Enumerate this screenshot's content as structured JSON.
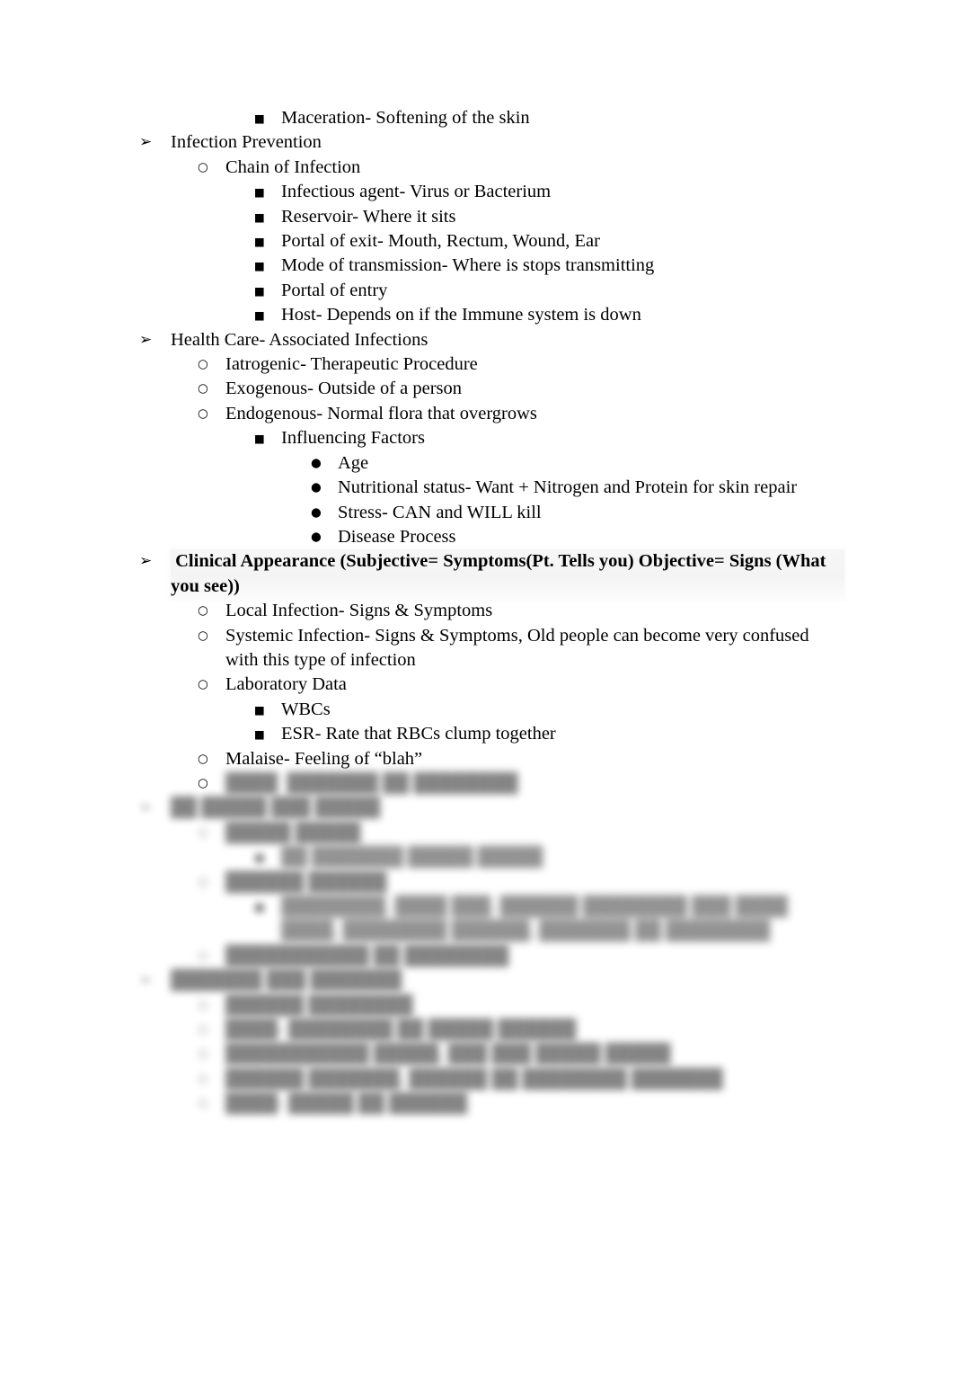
{
  "document": {
    "type": "outline-notes",
    "page_background": "#ffffff",
    "text_color": "#000000",
    "highlight_color": "#efefef",
    "bullet_glyphs": {
      "level_1": "➢",
      "level_2": "○",
      "level_3": "■",
      "level_4": "●"
    },
    "outline": [
      {
        "id": "l01",
        "level": 3,
        "text": "Maceration- Softening of the skin",
        "bold": false,
        "obscured": false
      },
      {
        "id": "l02",
        "level": 1,
        "text": "Infection Prevention",
        "bold": false,
        "obscured": false
      },
      {
        "id": "l03",
        "level": 2,
        "text": "Chain of Infection",
        "bold": false,
        "obscured": false
      },
      {
        "id": "l04",
        "level": 3,
        "text": "Infectious agent- Virus or Bacterium",
        "bold": false,
        "obscured": false
      },
      {
        "id": "l05",
        "level": 3,
        "text": "Reservoir- Where it sits",
        "bold": false,
        "obscured": false
      },
      {
        "id": "l06",
        "level": 3,
        "text": "Portal of exit- Mouth, Rectum, Wound, Ear",
        "bold": false,
        "obscured": false
      },
      {
        "id": "l07",
        "level": 3,
        "text": "Mode of transmission- Where is stops transmitting",
        "bold": false,
        "obscured": false
      },
      {
        "id": "l08",
        "level": 3,
        "text": "Portal of entry",
        "bold": false,
        "obscured": false
      },
      {
        "id": "l09",
        "level": 3,
        "text": "Host- Depends on if the Immune system is down",
        "bold": false,
        "obscured": false
      },
      {
        "id": "l10",
        "level": 1,
        "text": "Health Care- Associated Infections",
        "bold": false,
        "obscured": false
      },
      {
        "id": "l11",
        "level": 2,
        "text": "Iatrogenic- Therapeutic Procedure",
        "bold": false,
        "obscured": false
      },
      {
        "id": "l12",
        "level": 2,
        "text": "Exogenous- Outside of a person",
        "bold": false,
        "obscured": false
      },
      {
        "id": "l13",
        "level": 2,
        "text": "Endogenous- Normal flora that overgrows",
        "bold": false,
        "obscured": false
      },
      {
        "id": "l14",
        "level": 3,
        "text": "Influencing Factors",
        "bold": false,
        "obscured": false
      },
      {
        "id": "l15",
        "level": 4,
        "text": "Age",
        "bold": false,
        "obscured": false
      },
      {
        "id": "l16",
        "level": 4,
        "text": "Nutritional status- Want + Nitrogen and Protein for skin repair",
        "bold": false,
        "obscured": false
      },
      {
        "id": "l17",
        "level": 4,
        "text": "Stress- CAN and WILL kill",
        "bold": false,
        "obscured": false
      },
      {
        "id": "l18",
        "level": 4,
        "text": "Disease Process",
        "bold": false,
        "obscured": false
      },
      {
        "id": "l19",
        "level": 1,
        "text": " Clinical Appearance (Subjective= Symptoms(Pt. Tells you) Objective= Signs (What you see))",
        "bold": true,
        "highlight": true,
        "obscured": false
      },
      {
        "id": "l20",
        "level": 2,
        "text": "Local Infection- Signs & Symptoms",
        "bold": false,
        "obscured": false
      },
      {
        "id": "l21",
        "level": 2,
        "text": "Systemic Infection- Signs & Symptoms, Old people can become very confused with this type of infection",
        "bold": false,
        "obscured": false
      },
      {
        "id": "l22",
        "level": 2,
        "text": "Laboratory Data",
        "bold": false,
        "obscured": false
      },
      {
        "id": "l23",
        "level": 3,
        "text": "WBCs",
        "bold": false,
        "obscured": false
      },
      {
        "id": "l24",
        "level": 3,
        "text": "ESR- Rate that RBCs clump together",
        "bold": false,
        "obscured": false
      },
      {
        "id": "l25",
        "level": 2,
        "text": "Malaise- Feeling of “blah”",
        "bold": false,
        "obscured": false
      },
      {
        "id": "l26",
        "level": 2,
        "text": "████  ███████ ██ ████████",
        "bold": false,
        "obscured": true
      },
      {
        "id": "l27",
        "level": 1,
        "text": "██ █████ ███ █████",
        "bold": false,
        "obscured": true
      },
      {
        "id": "l28",
        "level": 2,
        "text": "█████ █████",
        "bold": false,
        "obscured": true
      },
      {
        "id": "l29",
        "level": 3,
        "text": "██ ███████ █████ █████",
        "bold": false,
        "obscured": true
      },
      {
        "id": "l30",
        "level": 2,
        "text": "██████ ██████",
        "bold": false,
        "obscured": true
      },
      {
        "id": "l31",
        "level": 3,
        "text": "████████, ████ ███, ██████ ████████ ███ ████ ████, ████████ ██████, ███████ ██ ████████",
        "bold": false,
        "obscured": true
      },
      {
        "id": "l32",
        "level": 2,
        "text": "███████████ ██ ████████",
        "bold": false,
        "obscured": true
      },
      {
        "id": "l33",
        "level": 1,
        "text": "███████ ███ ███████",
        "bold": false,
        "obscured": true
      },
      {
        "id": "l34",
        "level": 2,
        "text": "██████ ████████",
        "bold": false,
        "obscured": true
      },
      {
        "id": "l35",
        "level": 2,
        "text": "████- ████████ ██ █████ ██████",
        "bold": false,
        "obscured": true
      },
      {
        "id": "l36",
        "level": 2,
        "text": "███████████ █████, ███ ███ █████ █████",
        "bold": false,
        "obscured": true
      },
      {
        "id": "l37",
        "level": 2,
        "text": "██████ ███████, ██████ ██ ████████ ███████",
        "bold": false,
        "obscured": true
      },
      {
        "id": "l38",
        "level": 2,
        "text": "████- █████ ██ ██████",
        "bold": false,
        "obscured": true
      }
    ]
  }
}
